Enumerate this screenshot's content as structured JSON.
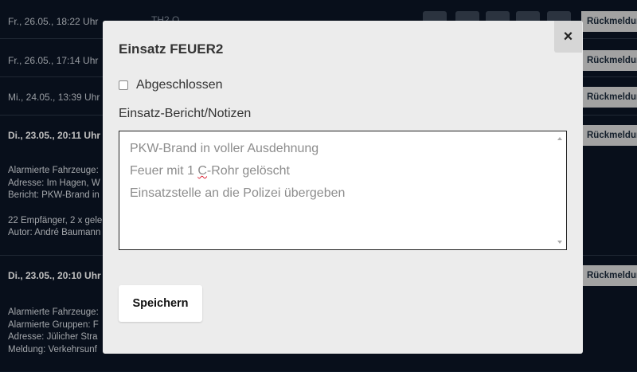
{
  "background": {
    "rows": [
      {
        "date": "Fr., 26.05., 18:22 Uhr",
        "tag": "TH2 O",
        "button": "Rückmeldung"
      },
      {
        "date": "Fr., 26.05., 17:14 Uhr",
        "button": "Rückmeldung"
      },
      {
        "date": "Mi., 24.05., 13:39 Uhr",
        "button": "Rückmeldung"
      },
      {
        "date": "Di., 23.05., 20:11 Uhr",
        "button": "Rückmeldung"
      },
      {
        "date": "Di., 23.05., 20:10 Uhr",
        "button": "Rückmeldung"
      }
    ],
    "detail_1": {
      "line1": "Alarmierte Fahrzeuge:",
      "line2": "Adresse: Im Hagen, W",
      "line3": "Bericht: PKW-Brand in",
      "line4": "22 Empfänger, 2 x gele",
      "line5": "Autor: André Baumann"
    },
    "detail_2": {
      "line1": "Alarmierte Fahrzeuge:",
      "line2": "Alarmierte Gruppen: F",
      "line3": "Adresse: Jülicher Stra",
      "line4": "Meldung: Verkehrsunf"
    }
  },
  "modal": {
    "title": "Einsatz FEUER2",
    "close_icon": "×",
    "checkbox_label": "Abgeschlossen",
    "notes_label": "Einsatz-Bericht/Notizen",
    "notes": {
      "line1": "PKW-Brand in voller Ausdehnung",
      "line2_a": "Feuer mit 1 ",
      "line2_b": "C",
      "line2_c": "-Rohr gelöscht",
      "line3": "Einsatzstelle an die Polizei übergeben"
    },
    "save_label": "Speichern"
  }
}
